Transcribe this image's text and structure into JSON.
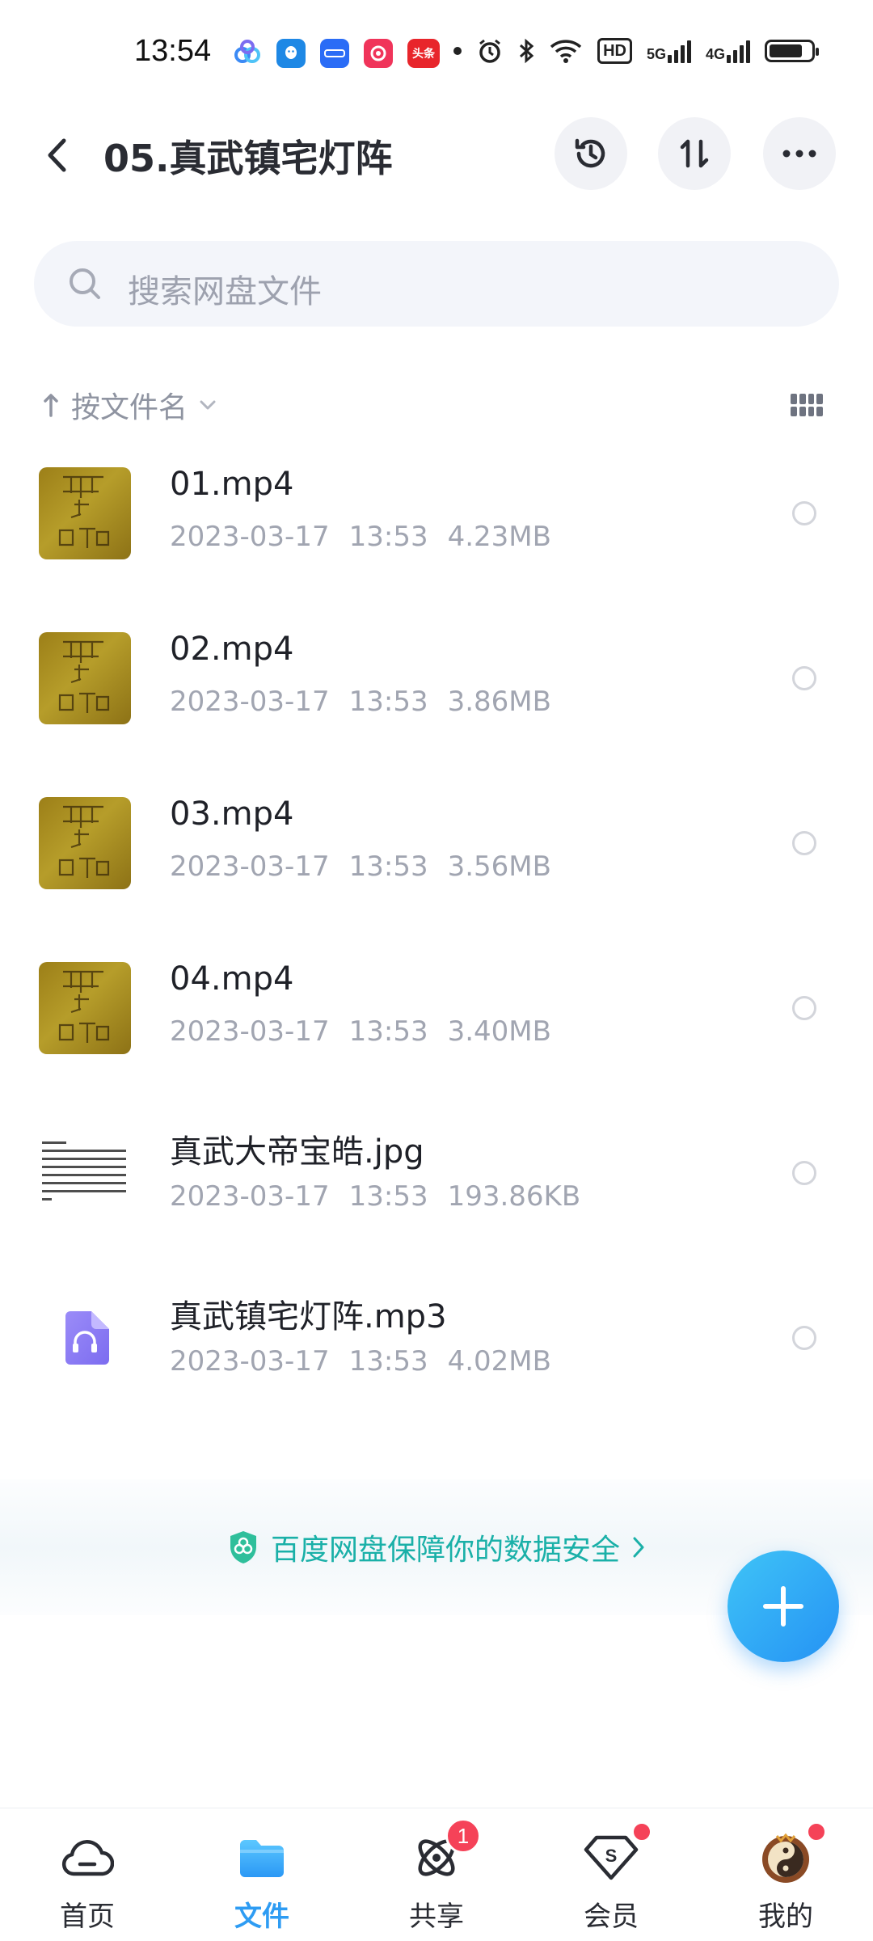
{
  "status_bar": {
    "time": "13:54",
    "app_icons": [
      "baidu-netdisk-icon",
      "qq-icon",
      "baidu-icon",
      "huodong-icon",
      "toutiao-icon"
    ],
    "toutiao_label": "头条",
    "network_5g": "5G",
    "network_4g": "4G",
    "hd_label": "HD",
    "battery_level": 0.8
  },
  "header": {
    "title": "05.真武镇宅灯阵",
    "actions": [
      "history-icon",
      "sort-icon",
      "more-icon"
    ]
  },
  "search": {
    "placeholder": "搜索网盘文件"
  },
  "sort": {
    "label": "按文件名"
  },
  "files": [
    {
      "name": "01.mp4",
      "date": "2023-03-17",
      "time": "13:53",
      "size": "4.23MB",
      "type": "video"
    },
    {
      "name": "02.mp4",
      "date": "2023-03-17",
      "time": "13:53",
      "size": "3.86MB",
      "type": "video"
    },
    {
      "name": "03.mp4",
      "date": "2023-03-17",
      "time": "13:53",
      "size": "3.56MB",
      "type": "video"
    },
    {
      "name": "04.mp4",
      "date": "2023-03-17",
      "time": "13:53",
      "size": "3.40MB",
      "type": "video"
    },
    {
      "name": "真武大帝宝皓.jpg",
      "date": "2023-03-17",
      "time": "13:53",
      "size": "193.86KB",
      "type": "image"
    },
    {
      "name": "真武镇宅灯阵.mp3",
      "date": "2023-03-17",
      "time": "13:53",
      "size": "4.02MB",
      "type": "audio"
    }
  ],
  "banner": {
    "text": "百度网盘保障你的数据安全"
  },
  "nav": {
    "items": [
      {
        "label": "首页",
        "icon": "home-cloud-icon"
      },
      {
        "label": "文件",
        "icon": "folder-icon"
      },
      {
        "label": "共享",
        "icon": "share-orbit-icon",
        "badge": "1"
      },
      {
        "label": "会员",
        "icon": "vip-diamond-icon"
      },
      {
        "label": "我的",
        "icon": "avatar-icon"
      }
    ]
  },
  "colors": {
    "accent": "#2e9cf3",
    "banner_text": "#1ab0a8",
    "badge": "#f54258"
  }
}
